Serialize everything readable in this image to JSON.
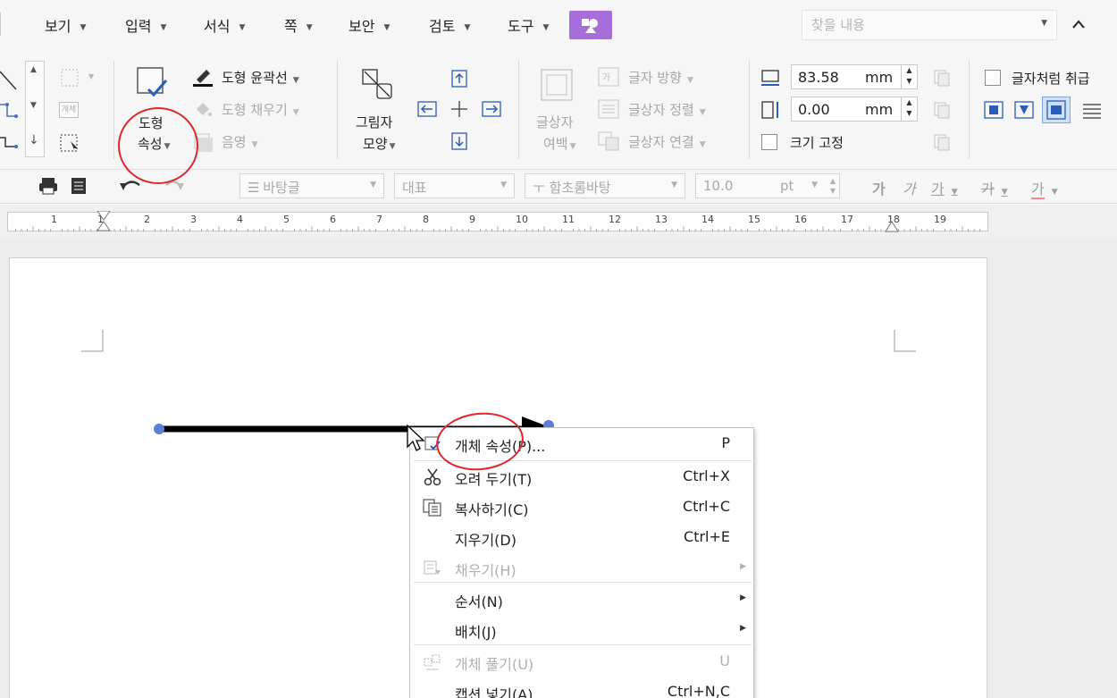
{
  "menu": {
    "items": [
      {
        "label": "보기"
      },
      {
        "label": "입력"
      },
      {
        "label": "서식"
      },
      {
        "label": "쪽"
      },
      {
        "label": "보안"
      },
      {
        "label": "검토"
      },
      {
        "label": "도구"
      }
    ],
    "search_placeholder": "찾을 내용"
  },
  "ribbon": {
    "shape_props_line1": "도형",
    "shape_props_line2": "속성",
    "shape_outline": "도형 윤곽선",
    "shape_fill": "도형 채우기",
    "shadow": "음영",
    "picture_style_line1": "그림자",
    "picture_style_line2": "모양",
    "textbox_margin_line1": "글상자",
    "textbox_margin_line2": "여백",
    "text_direction": "글자 방향",
    "text_align": "글상자 정렬",
    "text_link": "글상자 연결",
    "width_value": "83.58",
    "height_value": "0.00",
    "unit": "mm",
    "fix_size": "크기 고정",
    "treat_as_char": "글자처럼 취급",
    "small_label": "개체"
  },
  "toolbar": {
    "style": "바탕글",
    "lang": "대표",
    "font": "함초롬바탕",
    "size": "10.0",
    "size_unit": "pt",
    "glyph_a": "가",
    "glyph_b": "가",
    "glyph_c": "가",
    "glyph_d": "가",
    "glyph_e": "가"
  },
  "ruler": {
    "numbers": [
      "1",
      "1",
      "2",
      "3",
      "4",
      "5",
      "6",
      "7",
      "8",
      "9",
      "10",
      "11",
      "12",
      "13",
      "14",
      "15",
      "16",
      "17",
      "18",
      "19"
    ]
  },
  "context_menu": {
    "items": [
      {
        "label": "개체 속성(P)...",
        "shortcut": "P",
        "disabled": false
      },
      {
        "label": "오려 두기(T)",
        "shortcut": "Ctrl+X",
        "disabled": false
      },
      {
        "label": "복사하기(C)",
        "shortcut": "Ctrl+C",
        "disabled": false
      },
      {
        "label": "지우기(D)",
        "shortcut": "Ctrl+E",
        "disabled": false
      },
      {
        "label": "채우기(H)",
        "shortcut": "",
        "disabled": true
      },
      {
        "label": "순서(N)",
        "shortcut": "",
        "disabled": false
      },
      {
        "label": "배치(J)",
        "shortcut": "",
        "disabled": false
      },
      {
        "label": "개체 풀기(U)",
        "shortcut": "U",
        "disabled": true
      },
      {
        "label": "캡션 넣기(A)",
        "shortcut": "Ctrl+N,C",
        "disabled": false
      }
    ]
  },
  "colors": {
    "accent_purple": "#a56ed8",
    "highlight_red": "#e0262b",
    "handle_blue": "#5a7fd6"
  }
}
